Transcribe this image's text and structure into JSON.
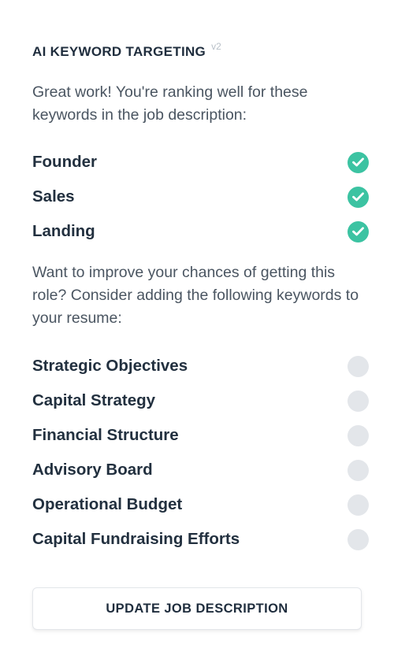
{
  "panel": {
    "title": "AI KEYWORD TARGETING",
    "version": "v2",
    "matched_intro": "Great work! You're ranking well for these keywords in the job description:",
    "matched_keywords": [
      {
        "label": "Founder",
        "status": "matched"
      },
      {
        "label": "Sales",
        "status": "matched"
      },
      {
        "label": "Landing",
        "status": "matched"
      }
    ],
    "suggest_intro": "Want to improve your chances of getting this role? Consider adding the following keywords to your resume:",
    "suggested_keywords": [
      {
        "label": "Strategic Objectives",
        "status": "missing"
      },
      {
        "label": "Capital Strategy",
        "status": "missing"
      },
      {
        "label": "Financial Structure",
        "status": "missing"
      },
      {
        "label": "Advisory Board",
        "status": "missing"
      },
      {
        "label": "Operational Budget",
        "status": "missing"
      },
      {
        "label": "Capital Fundraising Efforts",
        "status": "missing"
      }
    ],
    "button_label": "UPDATE JOB DESCRIPTION"
  },
  "icons": {
    "matched": "check-circle-icon",
    "missing": "empty-circle-icon"
  },
  "colors": {
    "accent_green": "#3cc3a2",
    "empty_circle": "#e3e6ea",
    "heading": "#1f2d3d",
    "body_text": "#4a5561",
    "version_tag": "#b8c0c8"
  }
}
